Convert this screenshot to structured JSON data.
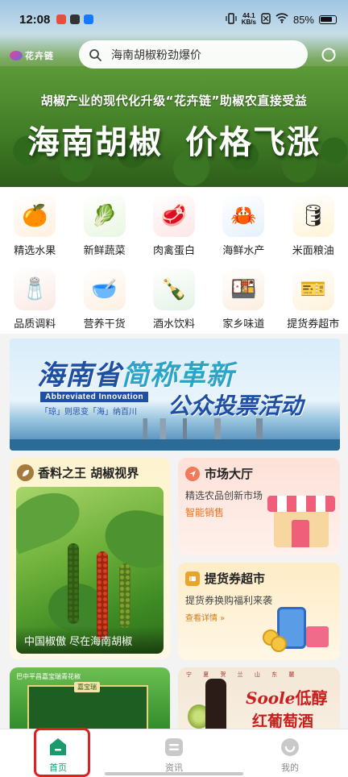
{
  "status_bar": {
    "time": "12:08",
    "speed_top": "44.1",
    "speed_bottom": "KB/s",
    "battery": "85%"
  },
  "header": {
    "brand_name": "花卉链",
    "search_placeholder": "海南胡椒粉劲爆价"
  },
  "hero": {
    "subtitle": "胡椒产业的现代化升级“花卉链”助椒农直接受益",
    "headline": "海南胡椒 价格飞涨"
  },
  "categories": [
    {
      "label": "精选水果",
      "icon": "grapefruit-icon",
      "glyph": "🍊"
    },
    {
      "label": "新鲜蔬菜",
      "icon": "vegetables-icon",
      "glyph": "🥬"
    },
    {
      "label": "肉禽蛋白",
      "icon": "meat-icon",
      "glyph": "🥩"
    },
    {
      "label": "海鲜水产",
      "icon": "crab-icon",
      "glyph": "🦀"
    },
    {
      "label": "米面粮油",
      "icon": "oil-bottle-icon",
      "glyph": "🛢"
    },
    {
      "label": "品质调料",
      "icon": "seasoning-pack-icon",
      "glyph": "🧂"
    },
    {
      "label": "营养干货",
      "icon": "dried-goods-icon",
      "glyph": "🥣"
    },
    {
      "label": "酒水饮料",
      "icon": "beer-bottles-icon",
      "glyph": "🍾"
    },
    {
      "label": "家乡味道",
      "icon": "snack-bag-icon",
      "glyph": "🍱"
    },
    {
      "label": "提货券超市",
      "icon": "coupon-card-icon",
      "glyph": "🎫"
    }
  ],
  "promo": {
    "line1_a": "海南省",
    "line1_b": "简称革新",
    "english": "Abbreviated Innovation",
    "sub": "「琼」则思变「海」纳百川",
    "line2": "公众投票活动"
  },
  "cards": {
    "pepper": {
      "title": "香料之王 胡椒视界",
      "caption": "中国椒傲  尽在海南胡椒"
    },
    "market": {
      "title": "市场大厅",
      "desc": "精选农品创新市场",
      "tag": "智能销售"
    },
    "coupon": {
      "title": "提货券超市",
      "desc": "提货券换购福利来袭",
      "more": "查看详情 »"
    },
    "bottom_left": {
      "small": "巴中平昌嘉宝瑞青花椒",
      "label": "嘉宝瑞"
    },
    "bottom_right": {
      "topline": "宁 夏 贺 兰 山 东 麓",
      "brand1": "Soole",
      "brand1b": "低醇",
      "brand2": "红葡萄酒"
    }
  },
  "bottom_nav": [
    {
      "label": "首页",
      "active": true
    },
    {
      "label": "资讯",
      "active": false
    },
    {
      "label": "我的",
      "active": false
    }
  ],
  "colors": {
    "accent_green": "#1b9a6e",
    "highlight_red": "#e02020",
    "promo_blue": "#1f4fa3"
  }
}
